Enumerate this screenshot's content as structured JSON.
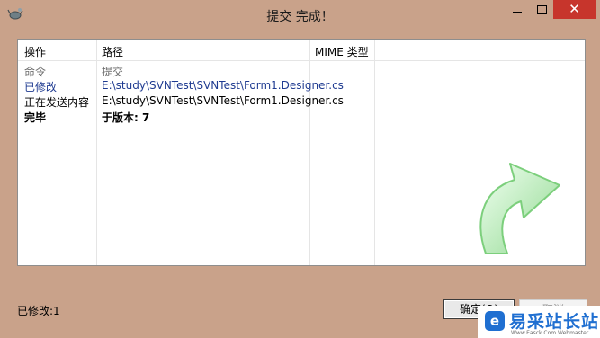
{
  "window": {
    "title": "提交 完成！",
    "close_glyph": "✕"
  },
  "list": {
    "headers": [
      "操作",
      "路径",
      "MIME 类型"
    ],
    "rows": [
      {
        "action": "命令",
        "path": "提交"
      },
      {
        "action": "已修改",
        "path": "E:\\study\\SVNTest\\SVNTest\\Form1.Designer.cs"
      },
      {
        "action": "正在发送内容",
        "path": "E:\\study\\SVNTest\\SVNTest\\Form1.Designer.cs"
      },
      {
        "action": "完毕",
        "path": "于版本: 7"
      }
    ]
  },
  "status": "已修改:1",
  "buttons": {
    "ok": "确定(O)",
    "cancel": "取消"
  },
  "watermark": {
    "logo": "e",
    "text": "易采站长站",
    "sub": "Www.Easck.Com  Webmaster"
  },
  "colors": {
    "window_bg": "#c9a28a",
    "close_bg": "#c7352c",
    "modified_text": "#1f3b91",
    "arrow_green": "#8fd98f"
  },
  "icons": {
    "app": "tortoise-icon",
    "arrow": "success-arrow-icon"
  }
}
